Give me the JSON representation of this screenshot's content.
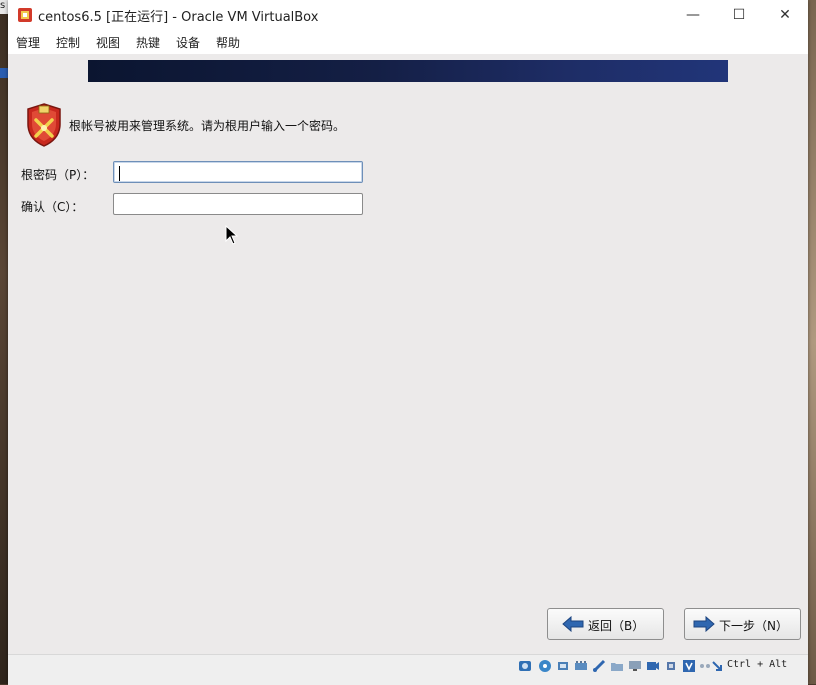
{
  "window": {
    "title": "centos6.5 [正在运行] - Oracle VM VirtualBox",
    "minimize_glyph": "—",
    "maximize_glyph": "☐",
    "close_glyph": "✕"
  },
  "menu": [
    "管理",
    "控制",
    "视图",
    "热键",
    "设备",
    "帮助"
  ],
  "installer": {
    "intro_text": "根帐号被用来管理系统。请为根用户输入一个密码。",
    "password_label": "根密码（P）：",
    "confirm_label": "确认（C）：",
    "password_value": "",
    "confirm_value": "",
    "back_button": "返回（B）",
    "next_button": "下一步（N）"
  },
  "statusbar": {
    "host_key": "Ctrl + Alt",
    "icons": [
      "hard-disk-icon",
      "optical-drive-icon",
      "audio-icon",
      "network-icon",
      "usb-icon",
      "shared-folder-icon",
      "display-icon",
      "video-capture-icon",
      "cpu-icon",
      "virtualization-icon",
      "mouse-integration-icon",
      "host-key-arrow-icon"
    ]
  },
  "colors": {
    "accent_blue": "#2f67b0",
    "banner_dark": "#0b1530",
    "shield_red": "#c8281e"
  }
}
